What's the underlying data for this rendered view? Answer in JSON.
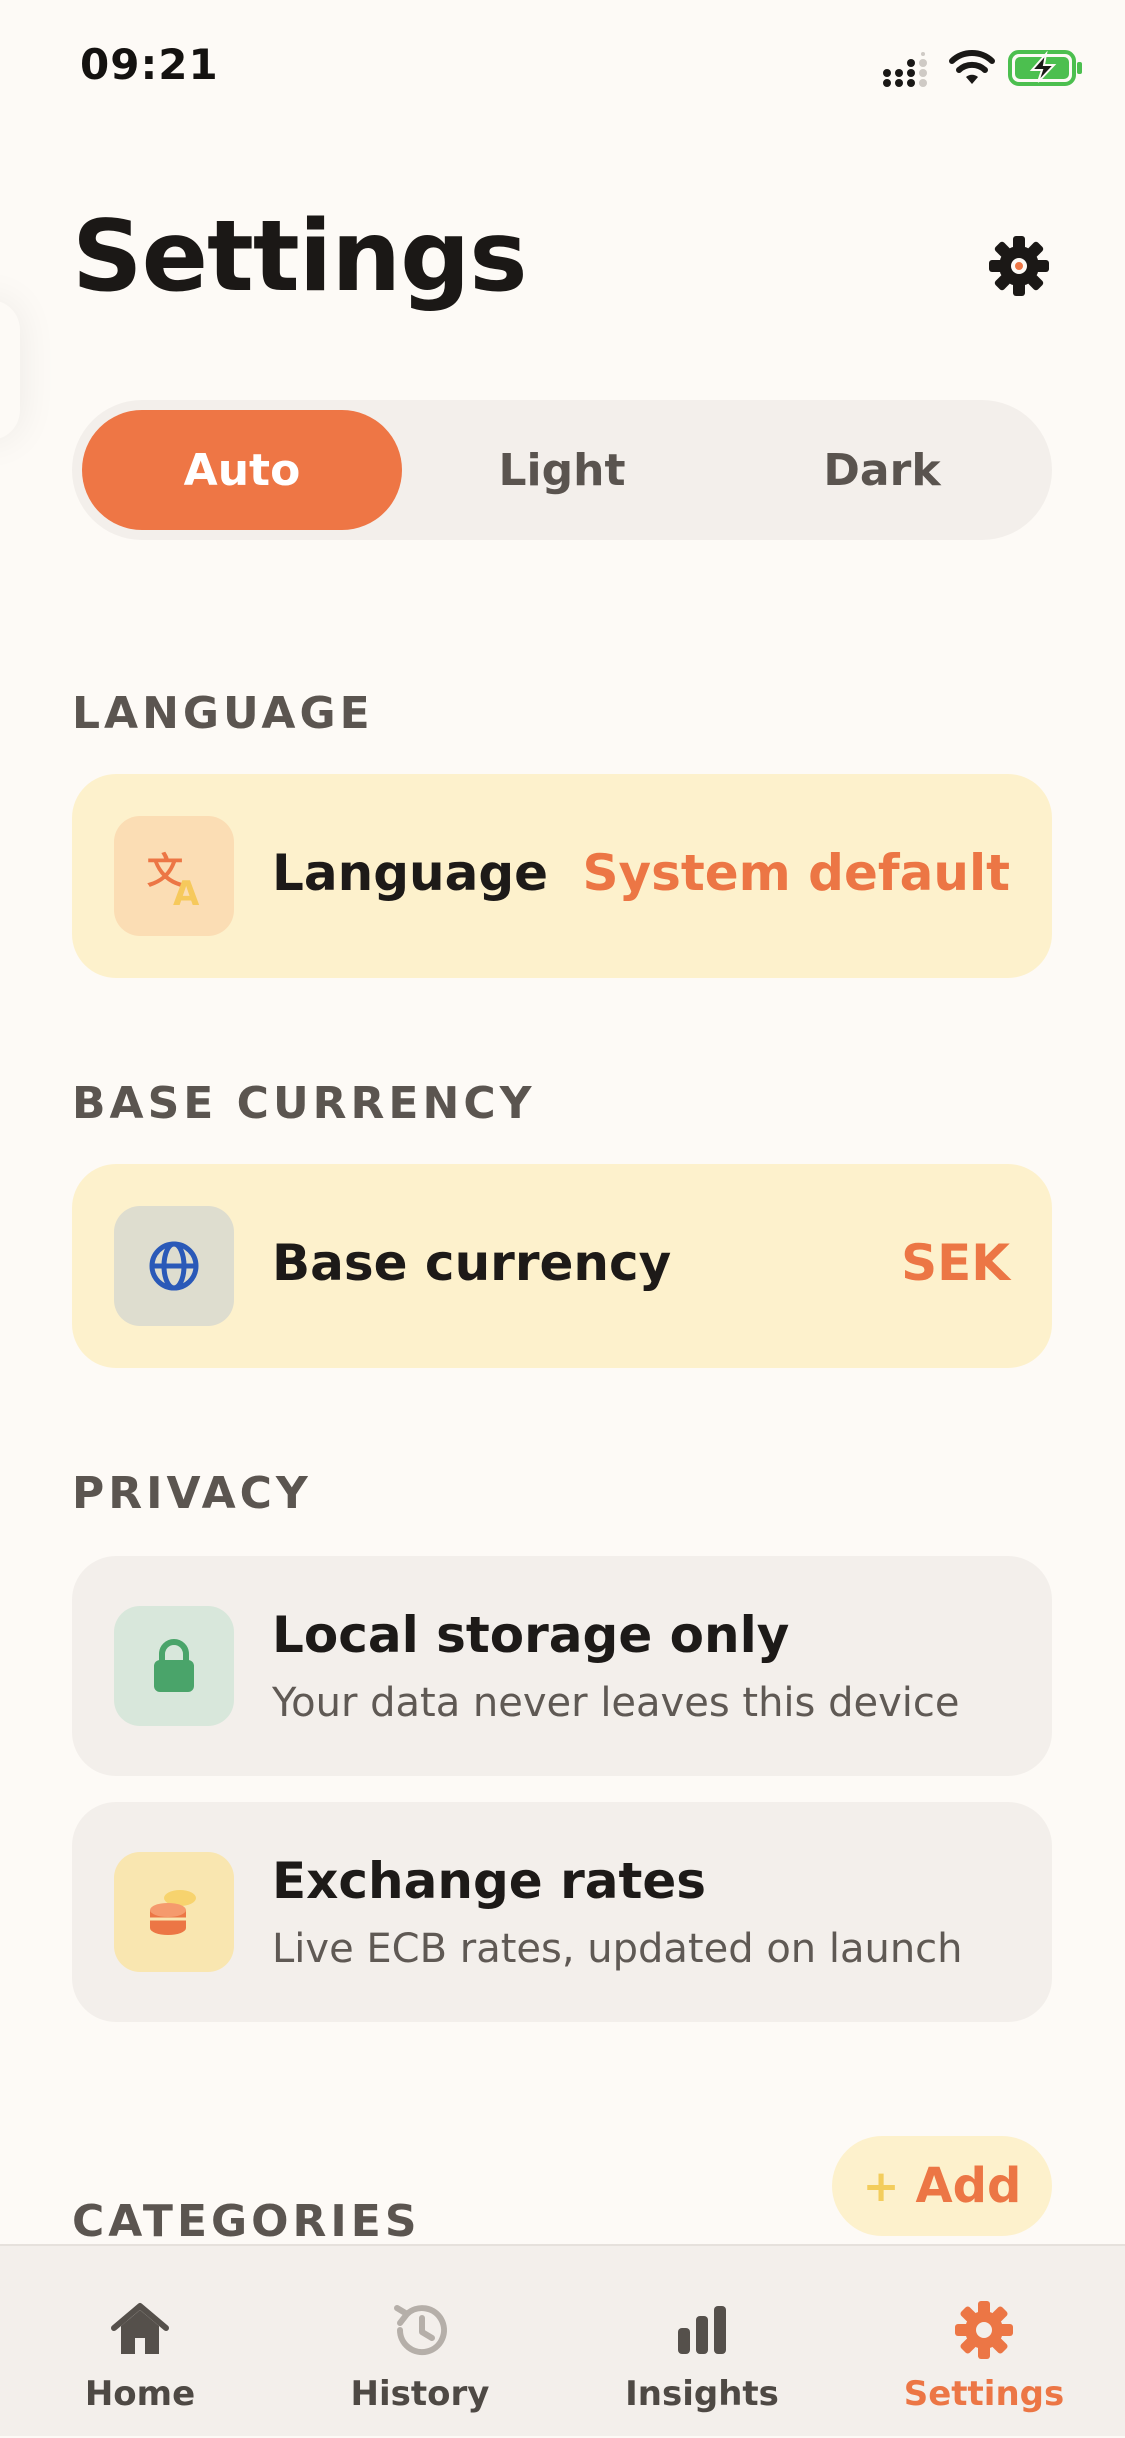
{
  "status_bar": {
    "time": "09:21"
  },
  "header": {
    "title": "Settings",
    "icon": "gear-icon"
  },
  "theme": {
    "options": [
      "Auto",
      "Light",
      "Dark"
    ],
    "selected": "Auto"
  },
  "sections": {
    "language": {
      "label": "LANGUAGE",
      "row": {
        "title": "Language",
        "value": "System default",
        "icon": "translate-icon"
      }
    },
    "base_currency": {
      "label": "BASE CURRENCY",
      "row": {
        "title": "Base currency",
        "value": "SEK",
        "icon": "globe-icon"
      }
    },
    "privacy": {
      "label": "PRIVACY",
      "rows": [
        {
          "title": "Local storage only",
          "subtitle": "Your data never leaves this device",
          "icon": "lock-icon"
        },
        {
          "title": "Exchange rates",
          "subtitle": "Live ECB rates, updated on launch",
          "icon": "coins-icon"
        }
      ]
    },
    "categories": {
      "label": "CATEGORIES",
      "add_label": "Add"
    }
  },
  "tab_bar": {
    "items": [
      {
        "label": "Home",
        "icon": "home-icon"
      },
      {
        "label": "History",
        "icon": "history-icon"
      },
      {
        "label": "Insights",
        "icon": "bar-chart-icon"
      },
      {
        "label": "Settings",
        "icon": "gear-icon"
      }
    ],
    "active": "Settings"
  },
  "colors": {
    "accent": "#ee7645",
    "background": "#fdfaf6",
    "card_yellow": "#fdf1cc",
    "card_gray": "#f3efeb",
    "battery_green": "#4cbf4f"
  }
}
